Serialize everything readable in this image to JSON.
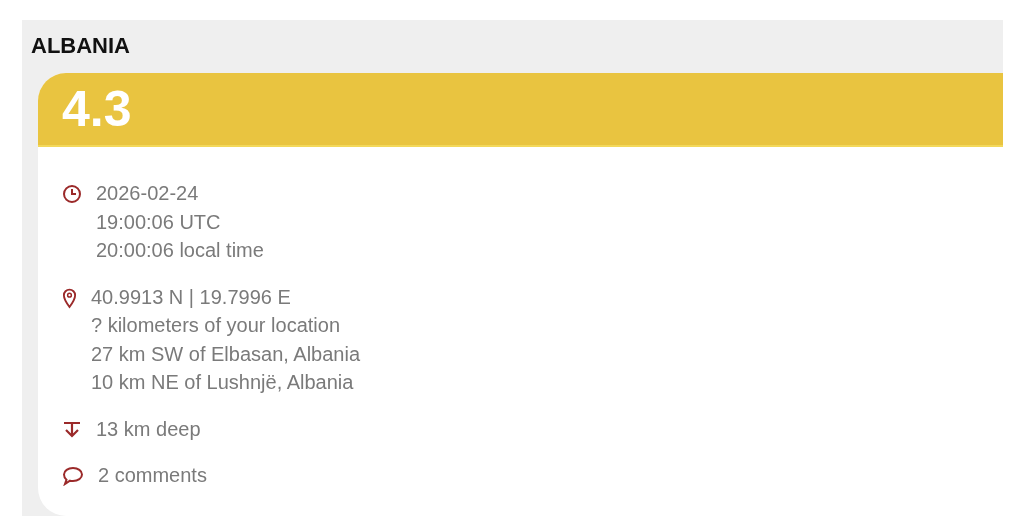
{
  "region": "ALBANIA",
  "magnitude": "4.3",
  "details": [
    {
      "kind": "time",
      "lines": [
        "2026-02-24",
        "19:00:06 UTC",
        "20:00:06 local time"
      ]
    },
    {
      "kind": "location",
      "lines": [
        "40.9913 N | 19.7996 E",
        "? kilometers of your location",
        "27 km SW of Elbasan, Albania",
        "10 km NE of Lushnjë, Albania"
      ]
    },
    {
      "kind": "depth",
      "lines": [
        "13 km deep"
      ]
    },
    {
      "kind": "comments",
      "lines": [
        "2 comments"
      ]
    }
  ]
}
